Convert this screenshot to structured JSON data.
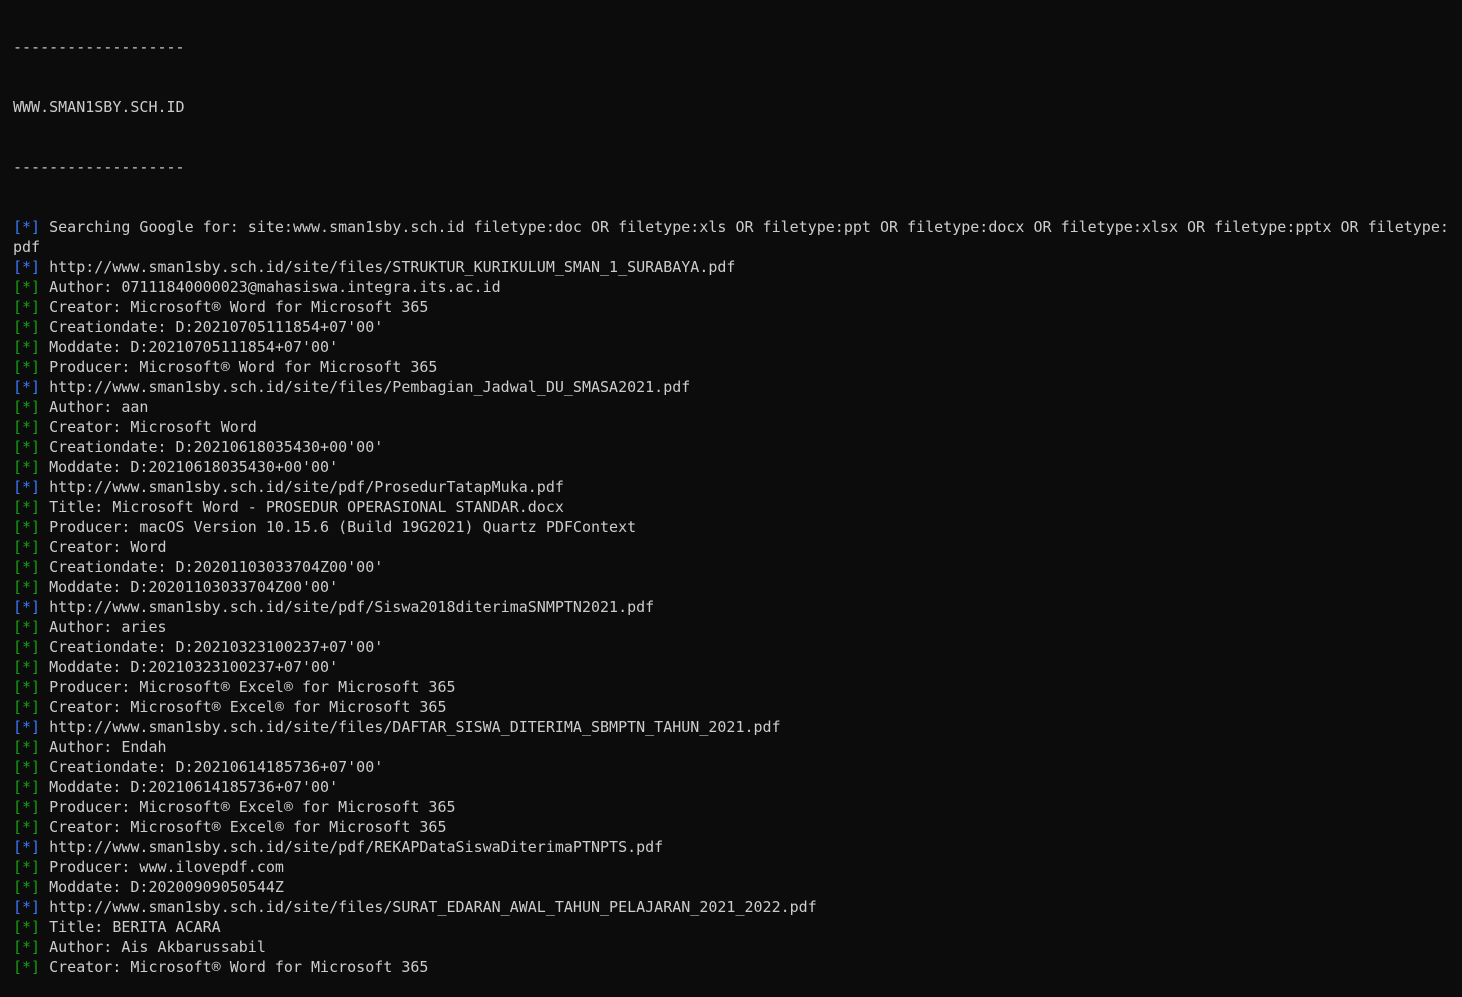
{
  "header": {
    "rule_top": "-------------------",
    "site": "WWW.SMAN1SBY.SCH.ID",
    "rule_bottom": "-------------------"
  },
  "colors": {
    "background": "#0c0c0c",
    "text": "#cccccc",
    "info_tag": "#3b78ff",
    "success_tag": "#13a10e"
  },
  "lines": [
    {
      "tag": "[*]",
      "color": "blue",
      "text": "Searching Google for: site:www.sman1sby.sch.id filetype:doc OR filetype:xls OR filetype:ppt OR filetype:docx OR filetype:xlsx OR filetype:pptx OR filetype:pdf",
      "wrap": true
    },
    {
      "tag": "[*]",
      "color": "blue",
      "text": "http://www.sman1sby.sch.id/site/files/STRUKTUR_KURIKULUM_SMAN_1_SURABAYA.pdf"
    },
    {
      "tag": "[*]",
      "color": "green",
      "text": "Author: 07111840000023@mahasiswa.integra.its.ac.id"
    },
    {
      "tag": "[*]",
      "color": "green",
      "text": "Creator: Microsoft® Word for Microsoft 365"
    },
    {
      "tag": "[*]",
      "color": "green",
      "text": "Creationdate: D:20210705111854+07'00'"
    },
    {
      "tag": "[*]",
      "color": "green",
      "text": "Moddate: D:20210705111854+07'00'"
    },
    {
      "tag": "[*]",
      "color": "green",
      "text": "Producer: Microsoft® Word for Microsoft 365"
    },
    {
      "tag": "[*]",
      "color": "blue",
      "text": "http://www.sman1sby.sch.id/site/files/Pembagian_Jadwal_DU_SMASA2021.pdf"
    },
    {
      "tag": "[*]",
      "color": "green",
      "text": "Author: aan"
    },
    {
      "tag": "[*]",
      "color": "green",
      "text": "Creator: Microsoft Word"
    },
    {
      "tag": "[*]",
      "color": "green",
      "text": "Creationdate: D:20210618035430+00'00'"
    },
    {
      "tag": "[*]",
      "color": "green",
      "text": "Moddate: D:20210618035430+00'00'"
    },
    {
      "tag": "[*]",
      "color": "blue",
      "text": "http://www.sman1sby.sch.id/site/pdf/ProsedurTatapMuka.pdf"
    },
    {
      "tag": "[*]",
      "color": "green",
      "text": "Title: Microsoft Word - PROSEDUR OPERASIONAL STANDAR.docx"
    },
    {
      "tag": "[*]",
      "color": "green",
      "text": "Producer: macOS Version 10.15.6 (Build 19G2021) Quartz PDFContext"
    },
    {
      "tag": "[*]",
      "color": "green",
      "text": "Creator: Word"
    },
    {
      "tag": "[*]",
      "color": "green",
      "text": "Creationdate: D:20201103033704Z00'00'"
    },
    {
      "tag": "[*]",
      "color": "green",
      "text": "Moddate: D:20201103033704Z00'00'"
    },
    {
      "tag": "[*]",
      "color": "blue",
      "text": "http://www.sman1sby.sch.id/site/pdf/Siswa2018diterimaSNMPTN2021.pdf"
    },
    {
      "tag": "[*]",
      "color": "green",
      "text": "Author: aries"
    },
    {
      "tag": "[*]",
      "color": "green",
      "text": "Creationdate: D:20210323100237+07'00'"
    },
    {
      "tag": "[*]",
      "color": "green",
      "text": "Moddate: D:20210323100237+07'00'"
    },
    {
      "tag": "[*]",
      "color": "green",
      "text": "Producer: Microsoft® Excel® for Microsoft 365"
    },
    {
      "tag": "[*]",
      "color": "green",
      "text": "Creator: Microsoft® Excel® for Microsoft 365"
    },
    {
      "tag": "[*]",
      "color": "blue",
      "text": "http://www.sman1sby.sch.id/site/files/DAFTAR_SISWA_DITERIMA_SBMPTN_TAHUN_2021.pdf"
    },
    {
      "tag": "[*]",
      "color": "green",
      "text": "Author: Endah"
    },
    {
      "tag": "[*]",
      "color": "green",
      "text": "Creationdate: D:20210614185736+07'00'"
    },
    {
      "tag": "[*]",
      "color": "green",
      "text": "Moddate: D:20210614185736+07'00'"
    },
    {
      "tag": "[*]",
      "color": "green",
      "text": "Producer: Microsoft® Excel® for Microsoft 365"
    },
    {
      "tag": "[*]",
      "color": "green",
      "text": "Creator: Microsoft® Excel® for Microsoft 365"
    },
    {
      "tag": "[*]",
      "color": "blue",
      "text": "http://www.sman1sby.sch.id/site/pdf/REKAPDataSiswaDiterimaPTNPTS.pdf"
    },
    {
      "tag": "[*]",
      "color": "green",
      "text": "Producer: www.ilovepdf.com"
    },
    {
      "tag": "[*]",
      "color": "green",
      "text": "Moddate: D:20200909050544Z"
    },
    {
      "tag": "[*]",
      "color": "blue",
      "text": "http://www.sman1sby.sch.id/site/files/SURAT_EDARAN_AWAL_TAHUN_PELAJARAN_2021_2022.pdf"
    },
    {
      "tag": "[*]",
      "color": "green",
      "text": "Title: BERITA ACARA"
    },
    {
      "tag": "[*]",
      "color": "green",
      "text": "Author: Ais Akbarussabil"
    },
    {
      "tag": "[*]",
      "color": "green",
      "text": "Creator: Microsoft® Word for Microsoft 365"
    }
  ]
}
